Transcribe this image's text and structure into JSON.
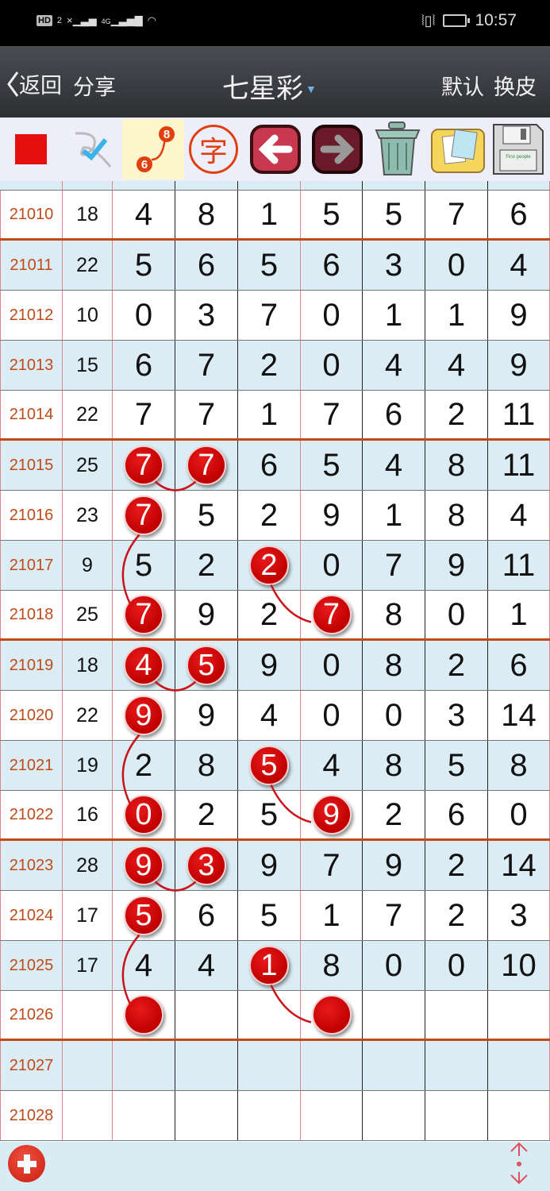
{
  "status_bar": {
    "left_icons": [
      "hd-icon",
      "sim2-icon",
      "signal-no-sim-icon",
      "signal-4g-icon",
      "wifi-icon"
    ],
    "hd_label": "HD",
    "sim_label": "2",
    "net_label": "4G",
    "time": "10:57",
    "right_icons": [
      "vibrate-icon",
      "battery-charging-icon"
    ]
  },
  "nav": {
    "back_label": "返回",
    "share_label": "分享",
    "title": "七星彩",
    "default_label": "默认",
    "skin_label": "换皮"
  },
  "toolbar": {
    "tools": [
      {
        "name": "red-square-tool",
        "label": "color"
      },
      {
        "name": "check-pen-tool",
        "label": "mark"
      },
      {
        "name": "connect-line-tool",
        "label": "connect",
        "n1": "8",
        "n2": "6",
        "active": true
      },
      {
        "name": "text-tool",
        "label": "字"
      },
      {
        "name": "undo-tool",
        "label": "back"
      },
      {
        "name": "redo-tool",
        "label": "forward"
      },
      {
        "name": "trash-tool",
        "label": "clear"
      },
      {
        "name": "gallery-tool",
        "label": "album"
      },
      {
        "name": "save-tool",
        "label": "save",
        "small_text": "First people"
      }
    ]
  },
  "colors": {
    "ball": "#d10000",
    "issue": "#c04a1a",
    "row_alt": "#dbecf4",
    "separator": "#c04a1a",
    "header_bg": "#2d2f33"
  },
  "rows": [
    {
      "issue": "21010",
      "sum": "18",
      "nums": [
        "4",
        "8",
        "1",
        "5",
        "5",
        "7",
        "6"
      ]
    },
    {
      "issue": "21011",
      "sum": "22",
      "nums": [
        "5",
        "6",
        "5",
        "6",
        "3",
        "0",
        "4"
      ]
    },
    {
      "issue": "21012",
      "sum": "10",
      "nums": [
        "0",
        "3",
        "7",
        "0",
        "1",
        "1",
        "9"
      ]
    },
    {
      "issue": "21013",
      "sum": "15",
      "nums": [
        "6",
        "7",
        "2",
        "0",
        "4",
        "4",
        "9"
      ]
    },
    {
      "issue": "21014",
      "sum": "22",
      "nums": [
        "7",
        "7",
        "1",
        "7",
        "6",
        "2",
        "11"
      ]
    },
    {
      "issue": "21015",
      "sum": "25",
      "nums": [
        "7",
        "7",
        "6",
        "5",
        "4",
        "8",
        "11"
      ]
    },
    {
      "issue": "21016",
      "sum": "23",
      "nums": [
        "7",
        "5",
        "2",
        "9",
        "1",
        "8",
        "4"
      ]
    },
    {
      "issue": "21017",
      "sum": "9",
      "nums": [
        "5",
        "2",
        "2",
        "0",
        "7",
        "9",
        "11"
      ]
    },
    {
      "issue": "21018",
      "sum": "25",
      "nums": [
        "7",
        "9",
        "2",
        "7",
        "8",
        "0",
        "1"
      ]
    },
    {
      "issue": "21019",
      "sum": "18",
      "nums": [
        "4",
        "5",
        "9",
        "0",
        "8",
        "2",
        "6"
      ]
    },
    {
      "issue": "21020",
      "sum": "22",
      "nums": [
        "9",
        "9",
        "4",
        "0",
        "0",
        "3",
        "14"
      ]
    },
    {
      "issue": "21021",
      "sum": "19",
      "nums": [
        "2",
        "8",
        "5",
        "4",
        "8",
        "5",
        "8"
      ]
    },
    {
      "issue": "21022",
      "sum": "16",
      "nums": [
        "0",
        "2",
        "5",
        "9",
        "2",
        "6",
        "0"
      ]
    },
    {
      "issue": "21023",
      "sum": "28",
      "nums": [
        "9",
        "3",
        "9",
        "7",
        "9",
        "2",
        "14"
      ]
    },
    {
      "issue": "21024",
      "sum": "17",
      "nums": [
        "5",
        "6",
        "5",
        "1",
        "7",
        "2",
        "3"
      ]
    },
    {
      "issue": "21025",
      "sum": "17",
      "nums": [
        "4",
        "4",
        "1",
        "8",
        "0",
        "0",
        "10"
      ]
    },
    {
      "issue": "21026",
      "sum": "",
      "nums": [
        "",
        "",
        "",
        "",
        "",
        "",
        ""
      ]
    },
    {
      "issue": "21027",
      "sum": "",
      "nums": [
        "",
        "",
        "",
        "",
        "",
        "",
        ""
      ]
    },
    {
      "issue": "21028",
      "sum": "",
      "nums": [
        "",
        "",
        "",
        "",
        "",
        "",
        ""
      ]
    }
  ],
  "balls": [
    {
      "row": 5,
      "col": 0
    },
    {
      "row": 5,
      "col": 1
    },
    {
      "row": 6,
      "col": 0
    },
    {
      "row": 8,
      "col": 0
    },
    {
      "row": 7,
      "col": 2
    },
    {
      "row": 8,
      "col": 3
    },
    {
      "row": 9,
      "col": 0
    },
    {
      "row": 9,
      "col": 1
    },
    {
      "row": 10,
      "col": 0
    },
    {
      "row": 12,
      "col": 0
    },
    {
      "row": 11,
      "col": 2
    },
    {
      "row": 12,
      "col": 3
    },
    {
      "row": 13,
      "col": 0
    },
    {
      "row": 13,
      "col": 1
    },
    {
      "row": 14,
      "col": 0
    },
    {
      "row": 16,
      "col": 0
    },
    {
      "row": 15,
      "col": 2
    },
    {
      "row": 16,
      "col": 3
    }
  ],
  "links": [
    {
      "from": [
        5,
        0
      ],
      "to": [
        5,
        1
      ],
      "type": "h"
    },
    {
      "from": [
        6,
        0
      ],
      "to": [
        8,
        0
      ],
      "type": "v"
    },
    {
      "from": [
        7,
        2
      ],
      "to": [
        8,
        3
      ],
      "type": "d"
    },
    {
      "from": [
        9,
        0
      ],
      "to": [
        9,
        1
      ],
      "type": "h"
    },
    {
      "from": [
        10,
        0
      ],
      "to": [
        12,
        0
      ],
      "type": "v"
    },
    {
      "from": [
        11,
        2
      ],
      "to": [
        12,
        3
      ],
      "type": "d"
    },
    {
      "from": [
        13,
        0
      ],
      "to": [
        13,
        1
      ],
      "type": "h"
    },
    {
      "from": [
        14,
        0
      ],
      "to": [
        16,
        0
      ],
      "type": "v"
    },
    {
      "from": [
        15,
        2
      ],
      "to": [
        16,
        3
      ],
      "type": "d"
    }
  ],
  "footer": {
    "add_icon": "plus-icon",
    "scroll_icon": "scroll-up-down-icon"
  }
}
